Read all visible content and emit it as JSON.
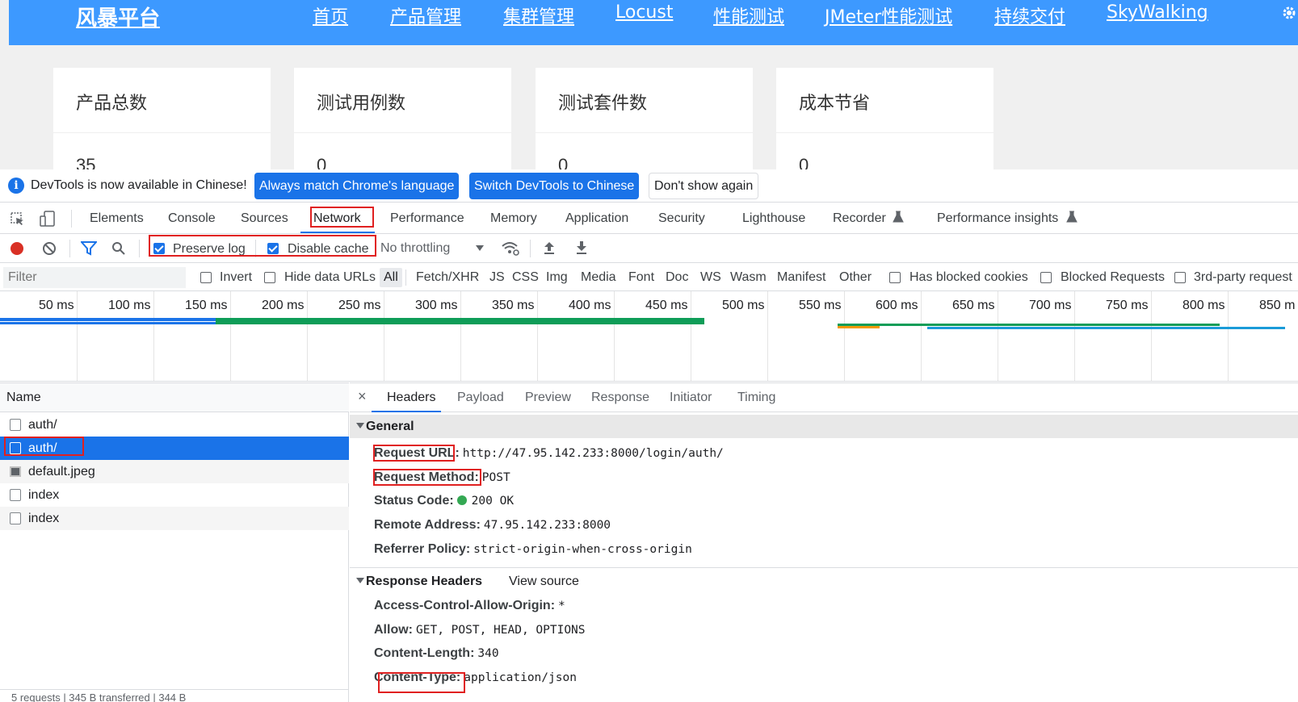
{
  "site": {
    "brand": "风暴平台",
    "nav": [
      "首页",
      "产品管理",
      "集群管理",
      "Locust",
      "性能测试",
      "JMeter性能测试",
      "持续交付",
      "SkyWalking"
    ],
    "cards": [
      {
        "title": "产品总数",
        "value": "35"
      },
      {
        "title": "测试用例数",
        "value": "0"
      },
      {
        "title": "测试套件数",
        "value": "0"
      },
      {
        "title": "成本节省",
        "value": "0"
      }
    ]
  },
  "infobar": {
    "icon": "i",
    "message": "DevTools is now available in Chinese!",
    "match_language": "Always match Chrome's language",
    "switch_chinese": "Switch DevTools to Chinese",
    "dont_show": "Don't show again"
  },
  "tabs": [
    "Elements",
    "Console",
    "Sources",
    "Network",
    "Performance",
    "Memory",
    "Application",
    "Security",
    "Lighthouse",
    "Recorder",
    "Performance insights"
  ],
  "active_tab": "Network",
  "toolbar": {
    "preserve_log": "Preserve log",
    "preserve_log_checked": true,
    "disable_cache": "Disable cache",
    "disable_cache_checked": true,
    "throttling": "No throttling"
  },
  "filter": {
    "placeholder": "Filter",
    "invert": "Invert",
    "hide_data_urls": "Hide data URLs",
    "types": [
      "All",
      "Fetch/XHR",
      "JS",
      "CSS",
      "Img",
      "Media",
      "Font",
      "Doc",
      "WS",
      "Wasm",
      "Manifest",
      "Other"
    ],
    "has_blocked_cookies": "Has blocked cookies",
    "blocked_requests": "Blocked Requests",
    "third_party": "3rd-party request"
  },
  "timeline": {
    "labels": [
      "50 ms",
      "100 ms",
      "150 ms",
      "200 ms",
      "250 ms",
      "300 ms",
      "350 ms",
      "400 ms",
      "450 ms",
      "500 ms",
      "550 ms",
      "600 ms",
      "650 ms",
      "700 ms",
      "750 ms",
      "800 ms",
      "850 m"
    ]
  },
  "requests": {
    "column_name": "Name",
    "items": [
      {
        "name": "auth/",
        "type": "doc",
        "selected": false
      },
      {
        "name": "auth/",
        "type": "doc",
        "selected": true
      },
      {
        "name": "default.jpeg",
        "type": "img",
        "selected": false
      },
      {
        "name": "index",
        "type": "doc",
        "selected": false
      },
      {
        "name": "index",
        "type": "doc",
        "selected": false
      }
    ],
    "status_strip": "5 requests  |  345 B transferred  |  344 B"
  },
  "detail": {
    "tabs": [
      "Headers",
      "Payload",
      "Preview",
      "Response",
      "Initiator",
      "Timing"
    ],
    "active_tab": "Headers",
    "general_title": "General",
    "general": [
      {
        "key": "Request URL",
        "value": "http://47.95.142.233:8000/login/auth/"
      },
      {
        "key": "Request Method",
        "value": "POST"
      },
      {
        "key": "Status Code",
        "value": "200 OK"
      },
      {
        "key": "Remote Address",
        "value": "47.95.142.233:8000"
      },
      {
        "key": "Referrer Policy",
        "value": "strict-origin-when-cross-origin"
      }
    ],
    "response_title": "Response Headers",
    "view_source": "View source",
    "response": [
      {
        "key": "Access-Control-Allow-Origin",
        "value": "*"
      },
      {
        "key": "Allow",
        "value": "GET, POST, HEAD, OPTIONS"
      },
      {
        "key": "Content-Length",
        "value": "340"
      },
      {
        "key": "Content-Type",
        "value": "application/json"
      }
    ]
  },
  "colors": {
    "nav_bg": "#3d99ff",
    "accent": "#1a73e8",
    "annotation_red": "#e02020",
    "status_ok": "#34a853"
  }
}
